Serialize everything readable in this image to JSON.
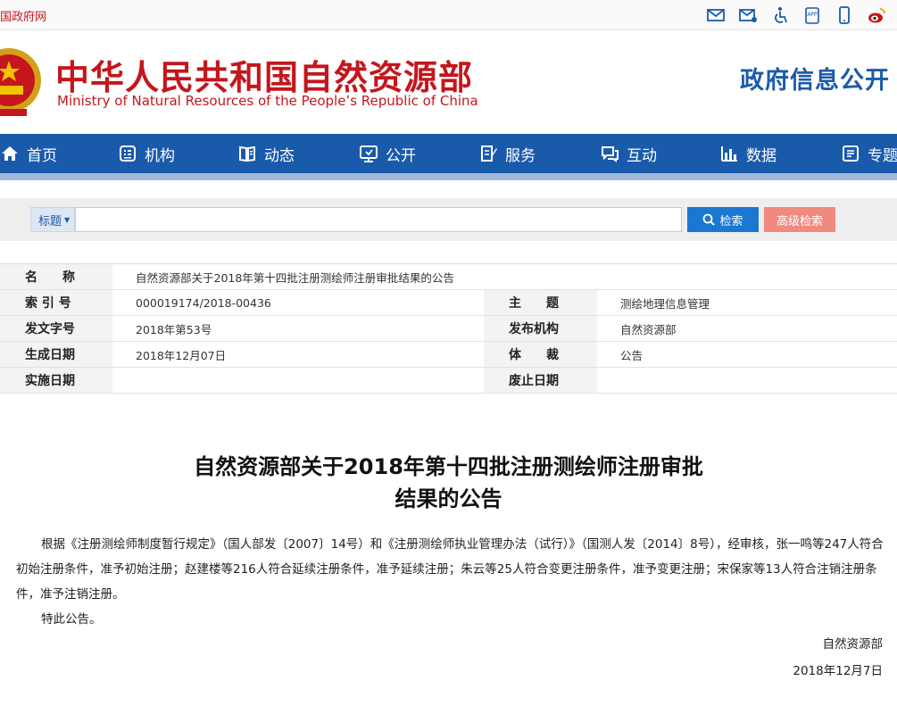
{
  "topbar": {
    "site_link": "国政府网",
    "utils": [
      "mail-icon",
      "feedback-mail-icon",
      "accessibility-icon",
      "app-icon",
      "mobile-icon",
      "weibo-icon"
    ]
  },
  "header": {
    "cn_title": "中华人民共和国自然资源部",
    "en_title": "Ministry of Natural Resources of the People’s Republic of China",
    "right_title": "政府信息公开"
  },
  "nav": {
    "items": [
      {
        "label": "首页",
        "icon": "home-icon"
      },
      {
        "label": "机构",
        "icon": "organization-icon"
      },
      {
        "label": "动态",
        "icon": "news-icon"
      },
      {
        "label": "公开",
        "icon": "disclosure-icon"
      },
      {
        "label": "服务",
        "icon": "service-icon"
      },
      {
        "label": "互动",
        "icon": "interaction-icon"
      },
      {
        "label": "数据",
        "icon": "data-chart-icon"
      },
      {
        "label": "专题",
        "icon": "topic-icon"
      }
    ]
  },
  "search": {
    "select_value": "标题",
    "input_value": "",
    "search_label": "检索",
    "advanced_label": "高级检索"
  },
  "info": {
    "name_label": "名　　称",
    "name_value": "自然资源部关于2018年第十四批注册测绘师注册审批结果的公告",
    "index_label": "索 引 号",
    "index_value": "000019174/2018-00436",
    "theme_label": "主　　题",
    "theme_value": "测绘地理信息管理",
    "docno_label": "发文字号",
    "docno_value": "2018年第53号",
    "publisher_label": "发布机构",
    "publisher_value": "自然资源部",
    "created_label": "生成日期",
    "created_value": "2018年12月07日",
    "genre_label": "体　　裁",
    "genre_value": "公告",
    "effective_label": "实施日期",
    "effective_value": "",
    "abolish_label": "废止日期",
    "abolish_value": ""
  },
  "article": {
    "title_line1": "自然资源部关于2018年第十四批注册测绘师注册审批",
    "title_line2": "结果的公告",
    "para1": "根据《注册测绘师制度暂行规定》（国人部发〔2007〕14号）和《注册测绘师执业管理办法（试行）》（国测人发〔2014〕8号），经审核，张一鸣等247人符合初始注册条件，准予初始注册；赵建楼等216人符合延续注册条件，准予延续注册；朱云等25人符合变更注册条件，准予变更注册；宋保家等13人符合注销注册条件，准予注销注册。",
    "para2": "特此公告。",
    "signer": "自然资源部",
    "date": "2018年12月7日"
  },
  "colors": {
    "brand_red": "#c4161c",
    "nav_blue": "#1a5aab",
    "search_blue": "#1a78d2",
    "advanced_pink": "#f08a80"
  }
}
